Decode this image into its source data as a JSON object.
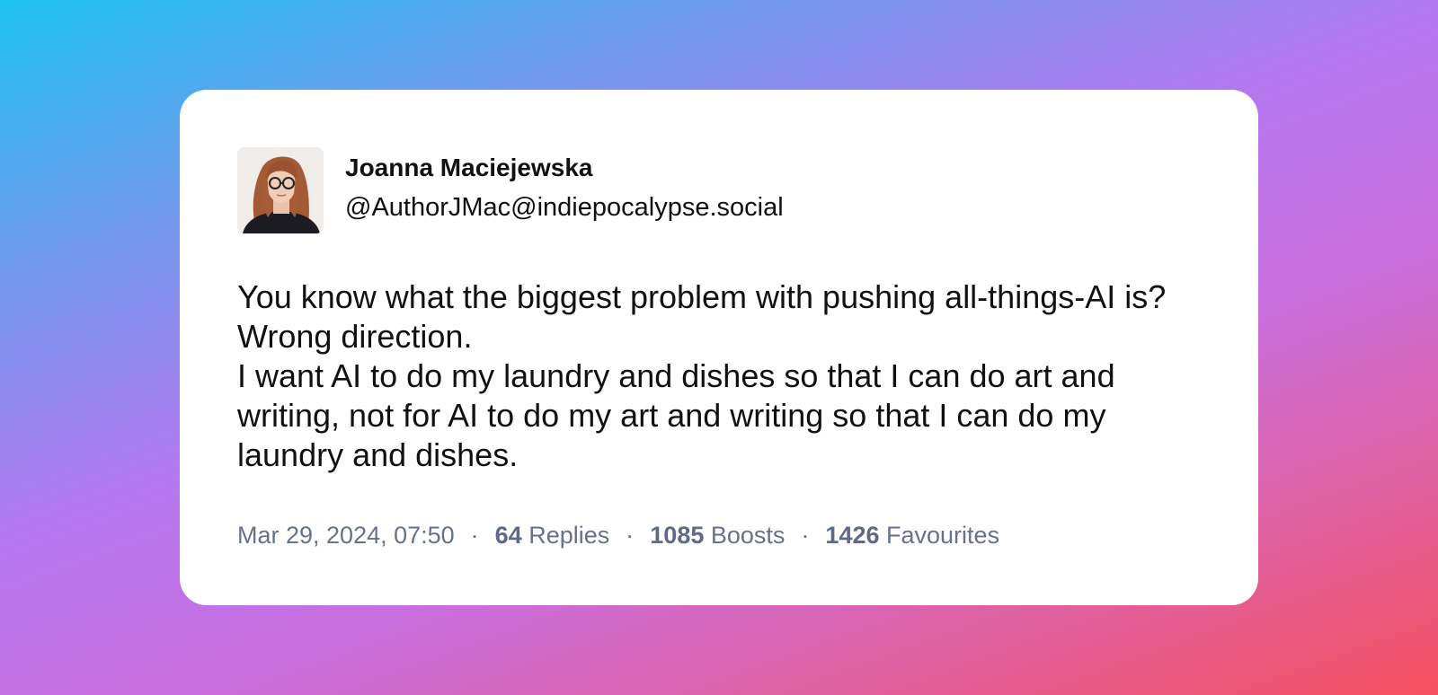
{
  "post": {
    "author": {
      "display_name": "Joanna Maciejewska",
      "handle": "@AuthorJMac@indiepocalypse.social"
    },
    "content": {
      "paragraph_1": "You know what the biggest problem with pushing all-things-AI is? Wrong direction.",
      "paragraph_2": "I want AI to do my laundry and dishes so that I can do art and writing, not for AI to do my art and writing so that I can do my laundry and dishes."
    },
    "meta": {
      "timestamp": "Mar 29, 2024, 07:50",
      "separator": "·",
      "replies_count": "64",
      "replies_label": "Replies",
      "boosts_count": "1085",
      "boosts_label": "Boosts",
      "favourites_count": "1426",
      "favourites_label": "Favourites"
    }
  },
  "colors": {
    "gradient_start": "#1ec3ee",
    "gradient_mid": "#c86fe0",
    "gradient_end": "#f5505e",
    "meta_text": "#66718c"
  }
}
